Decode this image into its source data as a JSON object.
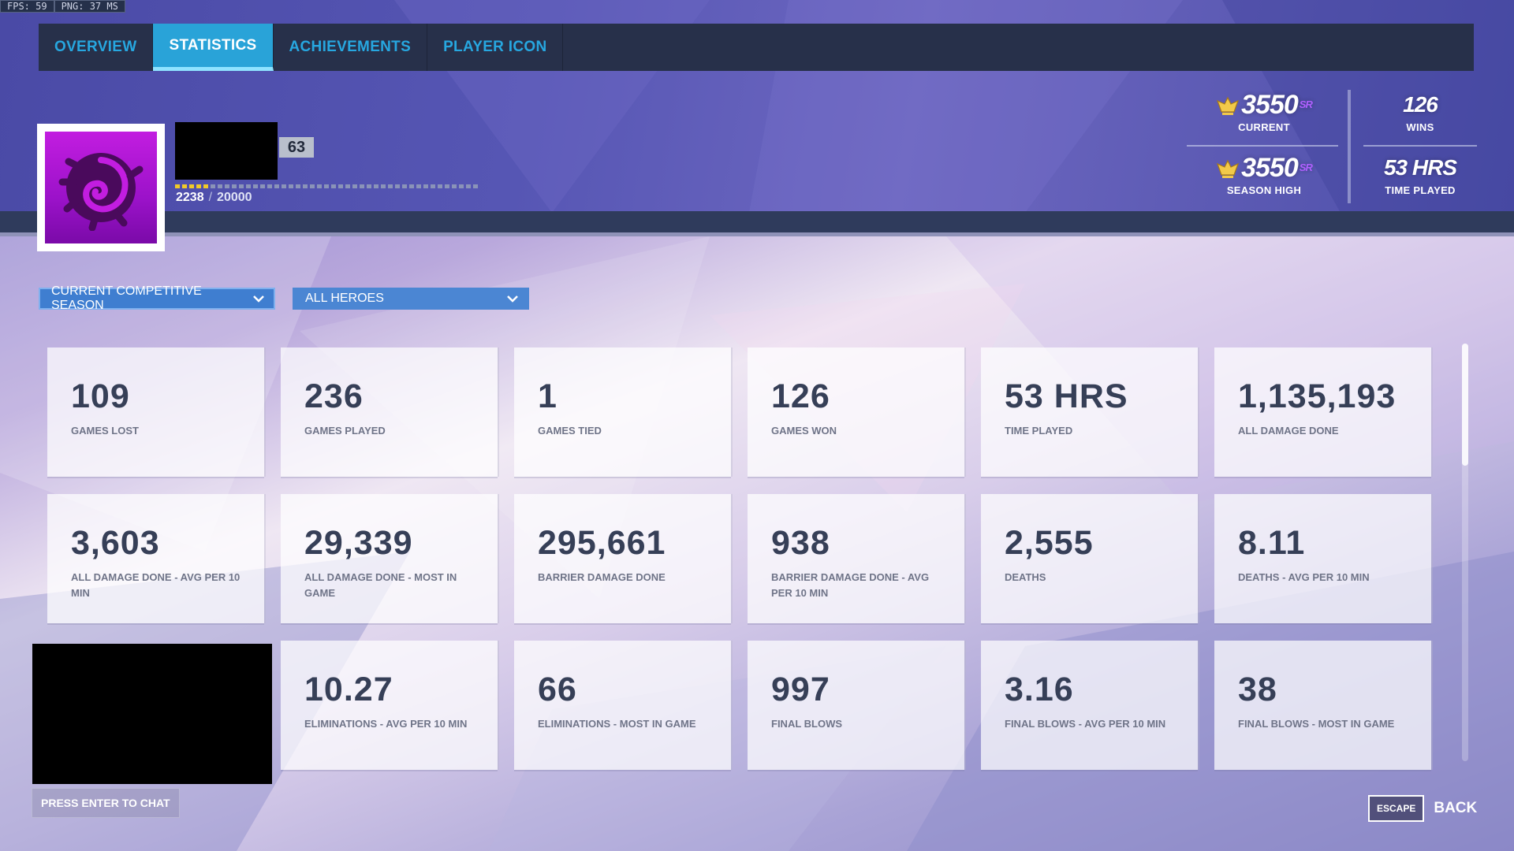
{
  "debug": {
    "fps": "FPS:  59",
    "png": "PNG:  37 MS"
  },
  "tabs": [
    {
      "label": "OVERVIEW",
      "active": false
    },
    {
      "label": "STATISTICS",
      "active": true
    },
    {
      "label": "ACHIEVEMENTS",
      "active": false
    },
    {
      "label": "PLAYER ICON",
      "active": false
    }
  ],
  "player": {
    "level": "63",
    "xp_current": "2238",
    "xp_sep": "/",
    "xp_max": "20000",
    "xp_progress": 0.112,
    "avatar_icon": "zerg-emblem-icon"
  },
  "rank": {
    "current_sr": "3550",
    "current_label": "CURRENT",
    "season_high_sr": "3550",
    "season_high_label": "SEASON HIGH",
    "sr_suffix": "SR",
    "wins_value": "126",
    "wins_label": "WINS",
    "time_value": "53 HRS",
    "time_label": "TIME PLAYED",
    "tier_icon": "master-rank-icon"
  },
  "filters": {
    "season": "CURRENT COMPETITIVE SEASON",
    "hero": "ALL HEROES"
  },
  "stats": [
    {
      "value": "109",
      "label": "GAMES LOST"
    },
    {
      "value": "236",
      "label": "GAMES PLAYED"
    },
    {
      "value": "1",
      "label": "GAMES TIED"
    },
    {
      "value": "126",
      "label": "GAMES WON"
    },
    {
      "value": "53 HRS",
      "label": "TIME PLAYED"
    },
    {
      "value": "1,135,193",
      "label": "ALL DAMAGE DONE"
    },
    {
      "value": "3,603",
      "label": "ALL DAMAGE DONE - AVG PER 10 MIN"
    },
    {
      "value": "29,339",
      "label": "ALL DAMAGE DONE - MOST IN GAME"
    },
    {
      "value": "295,661",
      "label": "BARRIER DAMAGE DONE"
    },
    {
      "value": "938",
      "label": "BARRIER DAMAGE DONE - AVG PER 10 MIN"
    },
    {
      "value": "2,555",
      "label": "DEATHS"
    },
    {
      "value": "8.11",
      "label": "DEATHS - AVG PER 10 MIN"
    },
    {
      "value": "",
      "label": ""
    },
    {
      "value": "10.27",
      "label": "ELIMINATIONS - AVG PER 10 MIN"
    },
    {
      "value": "66",
      "label": "ELIMINATIONS - MOST IN GAME"
    },
    {
      "value": "997",
      "label": "FINAL BLOWS"
    },
    {
      "value": "3.16",
      "label": "FINAL BLOWS - AVG PER 10 MIN"
    },
    {
      "value": "38",
      "label": "FINAL BLOWS - MOST IN GAME"
    }
  ],
  "footer": {
    "chat_hint": "PRESS ENTER TO CHAT",
    "escape_key": "ESCAPE",
    "back_label": "BACK"
  },
  "colors": {
    "accent": "#29a3d8",
    "tab_text": "#27a7e0",
    "xp_fill": "#f0c928",
    "avatar_bg": "#b017d6",
    "card_value": "#363f57"
  }
}
